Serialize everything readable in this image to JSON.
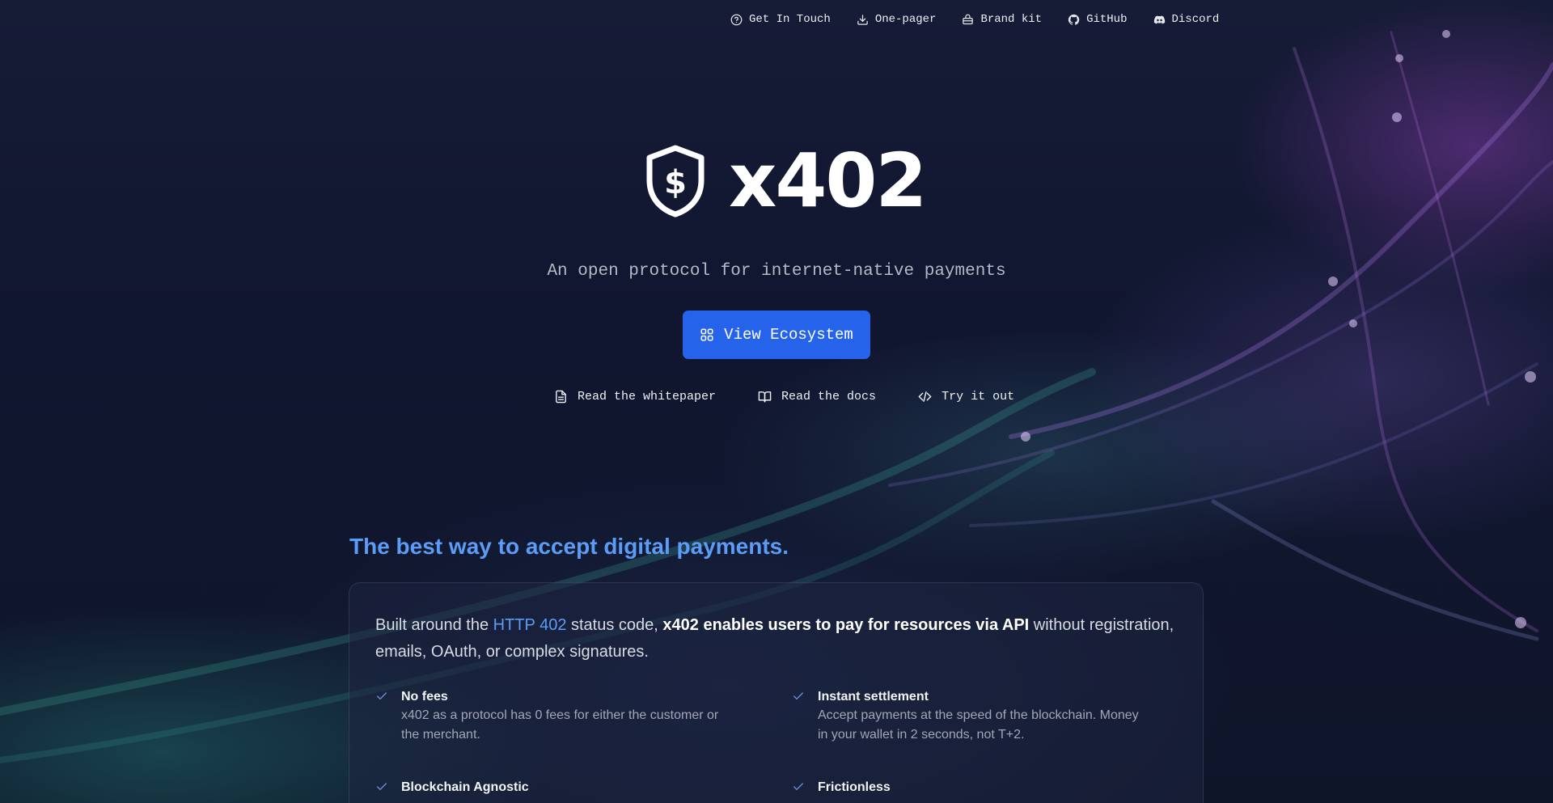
{
  "nav": {
    "items": [
      {
        "icon": "help-circle-icon",
        "label": "Get In Touch"
      },
      {
        "icon": "download-icon",
        "label": "One-pager"
      },
      {
        "icon": "toolbox-icon",
        "label": "Brand kit"
      },
      {
        "icon": "github-icon",
        "label": "GitHub"
      },
      {
        "icon": "discord-icon",
        "label": "Discord"
      }
    ]
  },
  "hero": {
    "logo_text": "x402",
    "tagline": "An open protocol for internet-native payments",
    "cta_label": "View Ecosystem",
    "links": [
      {
        "icon": "file-text-icon",
        "label": "Read the whitepaper"
      },
      {
        "icon": "book-open-icon",
        "label": "Read the docs"
      },
      {
        "icon": "code-icon",
        "label": "Try it out"
      }
    ]
  },
  "section": {
    "title": "The best way to accept digital payments.",
    "intro_prefix": "Built around the ",
    "intro_link": "HTTP 402",
    "intro_middle": " status code, ",
    "intro_bold": "x402 enables users to pay for resources via API",
    "intro_suffix": " without registration, emails, OAuth, or complex signatures.",
    "features": [
      {
        "title": "No fees",
        "desc": "x402 as a protocol has 0 fees for either the customer or the merchant."
      },
      {
        "title": "Instant settlement",
        "desc": "Accept payments at the speed of the blockchain. Money in your wallet in 2 seconds, not T+2."
      },
      {
        "title": "Blockchain Agnostic",
        "desc": ""
      },
      {
        "title": "Frictionless",
        "desc": ""
      }
    ]
  },
  "colors": {
    "accent": "#2563eb",
    "link": "#5b9cf6",
    "background": "#0f1428"
  }
}
